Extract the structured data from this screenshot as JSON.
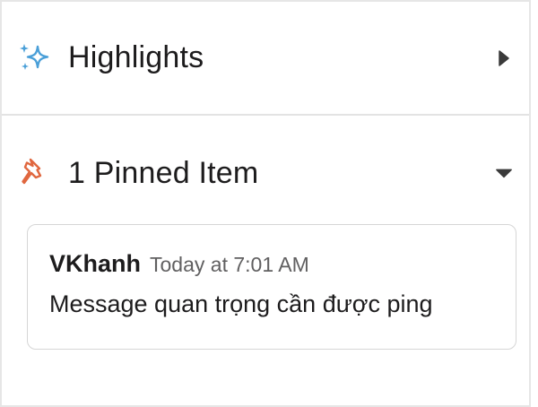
{
  "highlights": {
    "title": "Highlights",
    "icon": "sparkles-icon",
    "toggle_icon": "caret-right-icon",
    "icon_color": "#4a9fd8"
  },
  "pinned": {
    "title": "1 Pinned Item",
    "icon": "pin-icon",
    "toggle_icon": "caret-down-icon",
    "icon_color": "#e0673f",
    "items": [
      {
        "author": "VKhanh",
        "time": "Today at 7:01 AM",
        "text": "Message quan trọng cần được ping"
      }
    ]
  }
}
